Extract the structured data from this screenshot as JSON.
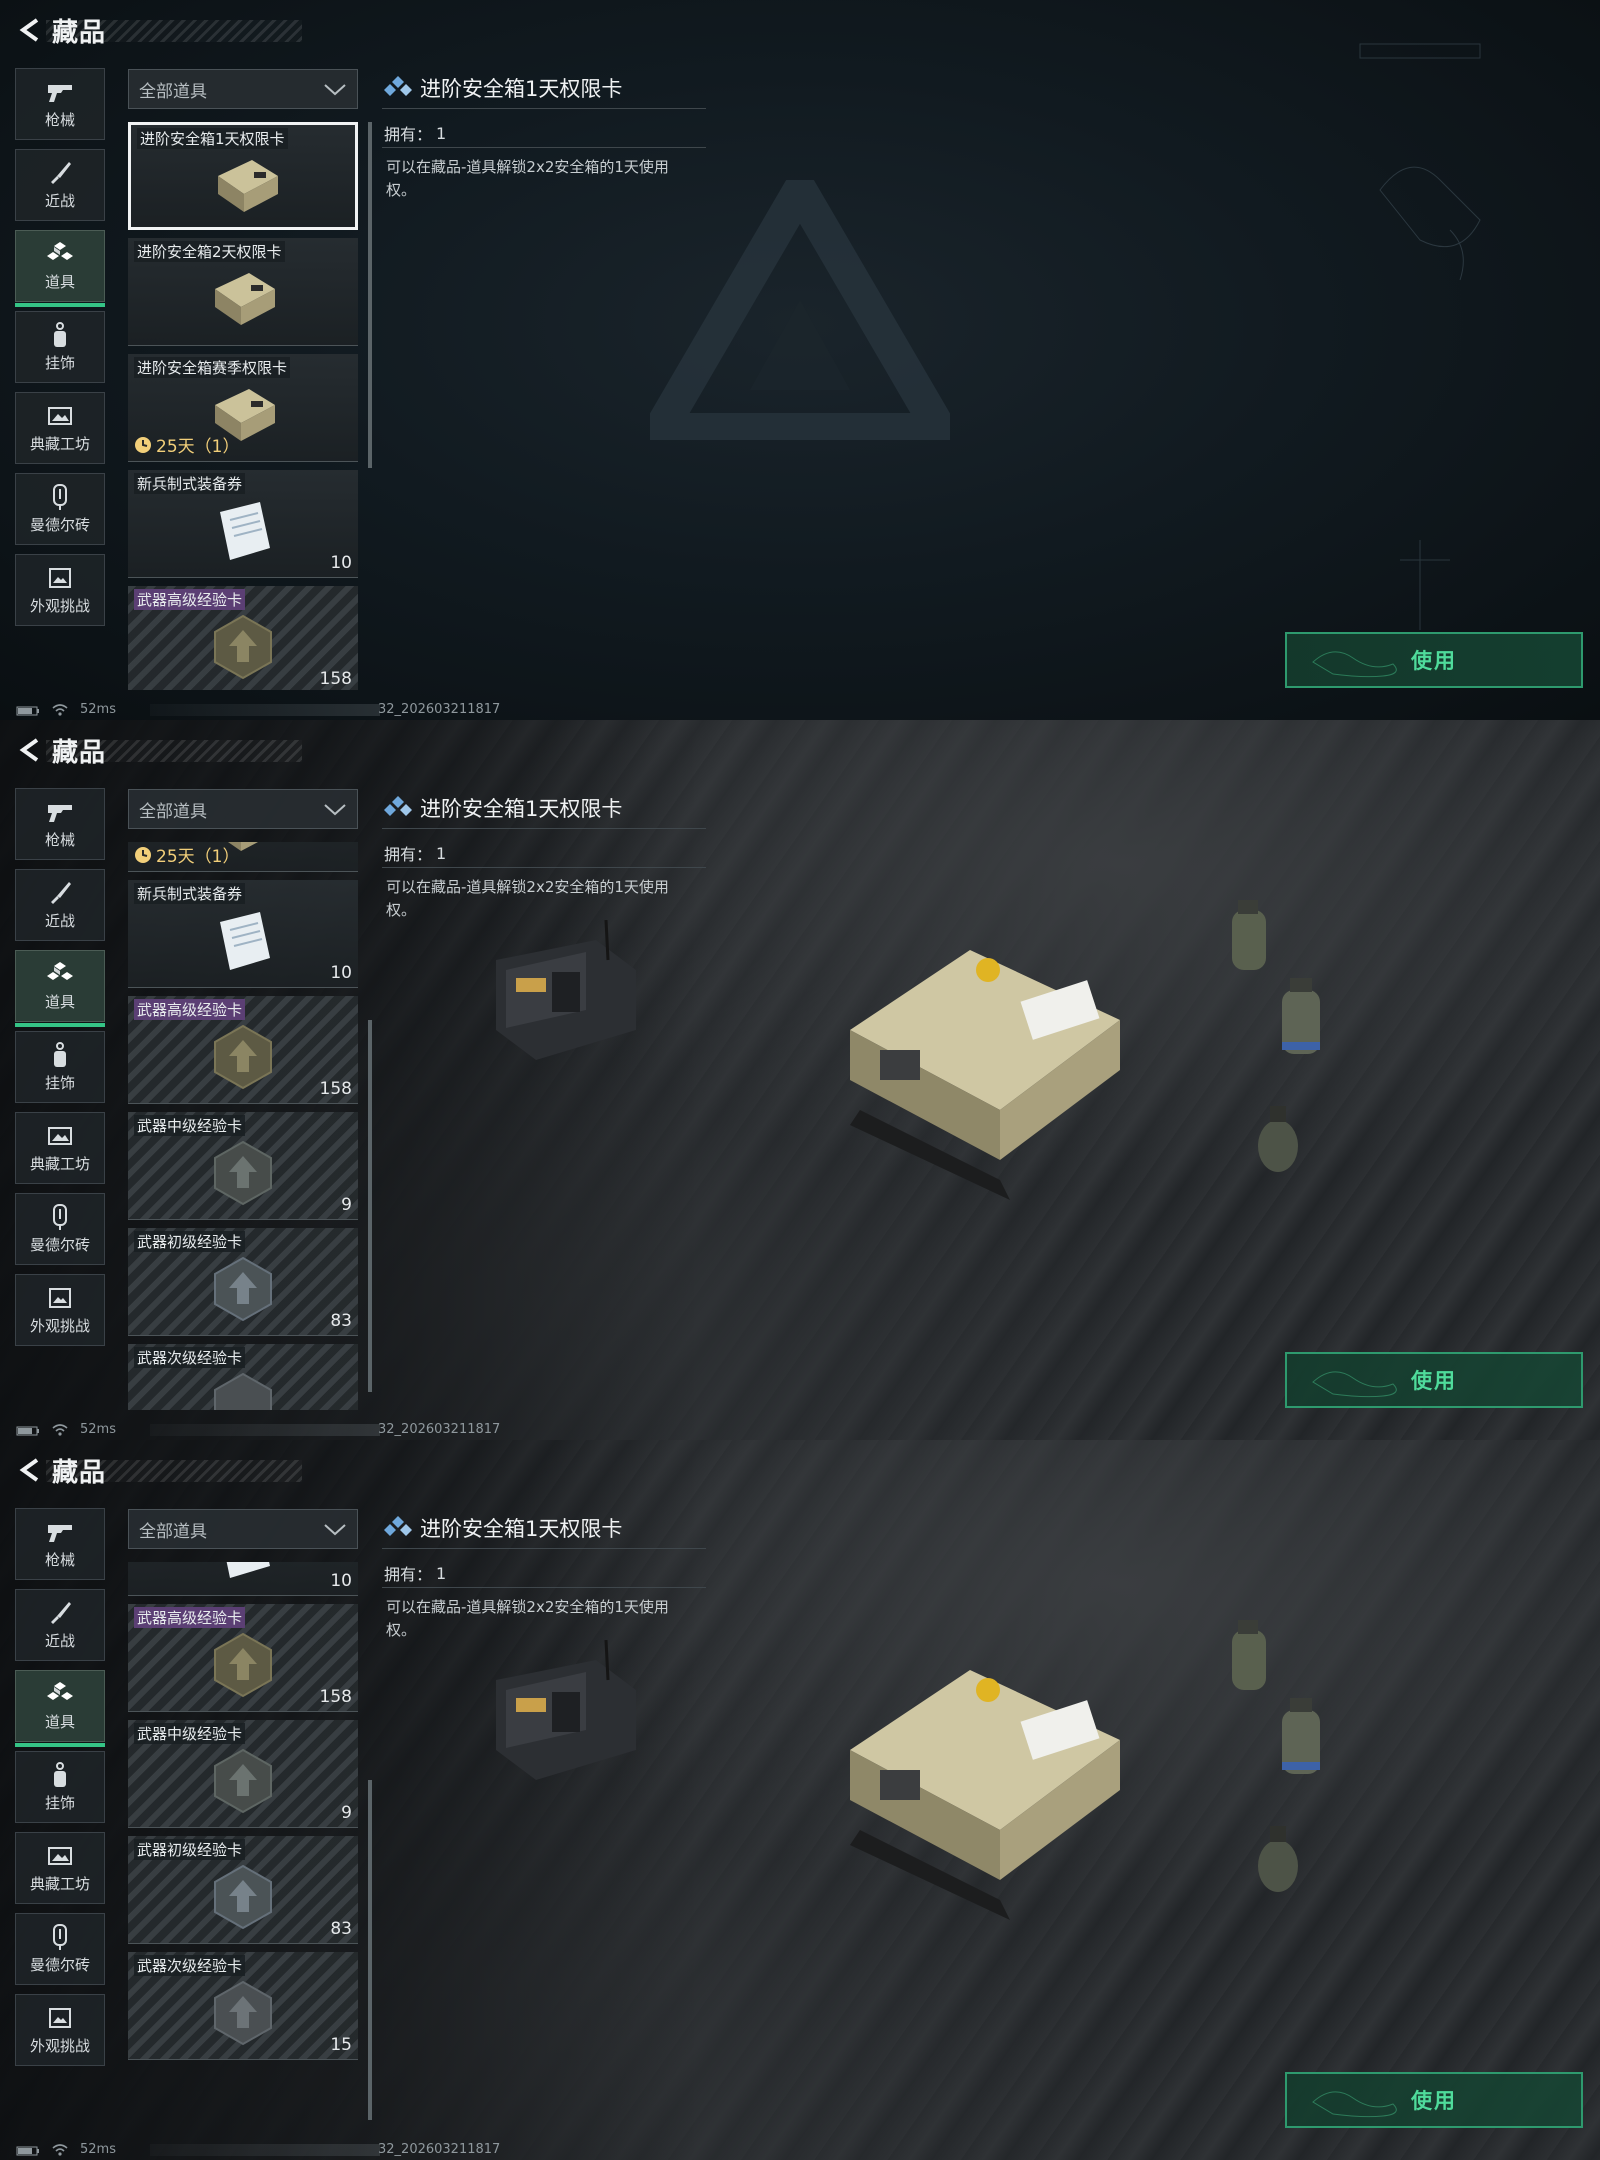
{
  "screens": [
    {
      "header": {
        "title": "藏品"
      },
      "sidebar": [
        {
          "label": "枪械",
          "icon": "gun-icon"
        },
        {
          "label": "近战",
          "icon": "knife-icon"
        },
        {
          "label": "道具",
          "icon": "props-icon",
          "active": true
        },
        {
          "label": "挂饰",
          "icon": "charm-icon"
        },
        {
          "label": "典藏工坊",
          "icon": "workshop-icon"
        },
        {
          "label": "曼德尔砖",
          "icon": "brick-icon"
        },
        {
          "label": "外观挑战",
          "icon": "challenge-icon"
        }
      ],
      "filter": {
        "label": "全部道具"
      },
      "items": [
        {
          "name": "进阶安全箱1天权限卡",
          "selected": true,
          "image": "case-icon"
        },
        {
          "name": "进阶安全箱2天权限卡",
          "image": "case-icon"
        },
        {
          "name": "进阶安全箱赛季权限卡",
          "timer": "25天（1）",
          "image": "case-icon"
        },
        {
          "name": "新兵制式装备券",
          "count": "10",
          "image": "document-icon"
        },
        {
          "name": "武器高级经验卡",
          "count": "158",
          "purple": true,
          "image": "hex-badge-icon"
        }
      ],
      "detail": {
        "title": "进阶安全箱1天权限卡",
        "own_label": "拥有：",
        "own_value": "1",
        "description": "可以在藏品-道具解锁2x2安全箱的1天使用权。"
      },
      "use_button": "使用",
      "status": {
        "ping": "52ms",
        "build": "32_202603211817"
      }
    },
    {
      "header": {
        "title": "藏品"
      },
      "sidebar": [
        {
          "label": "枪械",
          "icon": "gun-icon"
        },
        {
          "label": "近战",
          "icon": "knife-icon"
        },
        {
          "label": "道具",
          "icon": "props-icon",
          "active": true
        },
        {
          "label": "挂饰",
          "icon": "charm-icon"
        },
        {
          "label": "典藏工坊",
          "icon": "workshop-icon"
        },
        {
          "label": "曼德尔砖",
          "icon": "brick-icon"
        },
        {
          "label": "外观挑战",
          "icon": "challenge-icon"
        }
      ],
      "filter": {
        "label": "全部道具"
      },
      "items": [
        {
          "name": "",
          "timer": "25天（1）",
          "image": "case-icon"
        },
        {
          "name": "新兵制式装备券",
          "count": "10",
          "image": "document-icon"
        },
        {
          "name": "武器高级经验卡",
          "count": "158",
          "purple": true,
          "image": "hex-badge-icon"
        },
        {
          "name": "武器中级经验卡",
          "count": "9",
          "image": "hex-badge-icon"
        },
        {
          "name": "武器初级经验卡",
          "count": "83",
          "image": "hex-badge-icon"
        },
        {
          "name": "武器次级经验卡",
          "count": "",
          "image": "hex-badge-icon"
        }
      ],
      "detail": {
        "title": "进阶安全箱1天权限卡",
        "own_label": "拥有：",
        "own_value": "1",
        "description": "可以在藏品-道具解锁2x2安全箱的1天使用权。"
      },
      "use_button": "使用",
      "status": {
        "ping": "52ms",
        "build": "32_202603211817"
      }
    },
    {
      "header": {
        "title": "藏品"
      },
      "sidebar": [
        {
          "label": "枪械",
          "icon": "gun-icon"
        },
        {
          "label": "近战",
          "icon": "knife-icon"
        },
        {
          "label": "道具",
          "icon": "props-icon",
          "active": true
        },
        {
          "label": "挂饰",
          "icon": "charm-icon"
        },
        {
          "label": "典藏工坊",
          "icon": "workshop-icon"
        },
        {
          "label": "曼德尔砖",
          "icon": "brick-icon"
        },
        {
          "label": "外观挑战",
          "icon": "challenge-icon"
        }
      ],
      "filter": {
        "label": "全部道具"
      },
      "items": [
        {
          "name": "",
          "count": "10",
          "image": "document-icon"
        },
        {
          "name": "武器高级经验卡",
          "count": "158",
          "purple": true,
          "image": "hex-badge-icon"
        },
        {
          "name": "武器中级经验卡",
          "count": "9",
          "image": "hex-badge-icon"
        },
        {
          "name": "武器初级经验卡",
          "count": "83",
          "image": "hex-badge-icon"
        },
        {
          "name": "武器次级经验卡",
          "count": "15",
          "image": "hex-badge-icon"
        }
      ],
      "detail": {
        "title": "进阶安全箱1天权限卡",
        "own_label": "拥有：",
        "own_value": "1",
        "description": "可以在藏品-道具解锁2x2安全箱的1天使用权。"
      },
      "use_button": "使用",
      "status": {
        "ping": "52ms",
        "build": "32_202603211817"
      }
    }
  ],
  "colors": {
    "accent": "#35c486",
    "use_text": "#4fdb9b",
    "timer": "#f2cf7a",
    "purple_tag": "#5b3f74"
  }
}
